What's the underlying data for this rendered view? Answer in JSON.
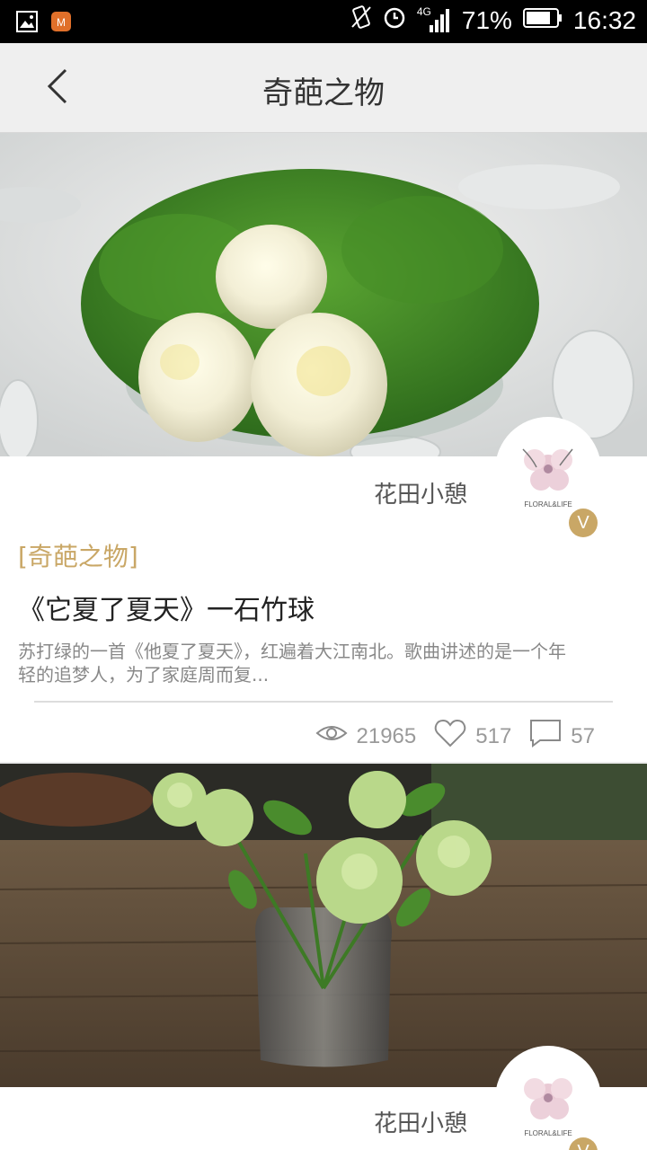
{
  "status_bar": {
    "left_icons": [
      "image-icon",
      "app-icon"
    ],
    "network": "4G",
    "battery": "71%",
    "time": "16:32"
  },
  "header": {
    "title": "奇葩之物",
    "back_icon": "chevron-left-icon"
  },
  "cards": [
    {
      "author": "花田小憩",
      "category": "[奇葩之物]",
      "title": "《它夏了夏天》一石竹球",
      "summary": "苏打绿的一首《他夏了夏天》，红遍着大江南北。歌曲讲述的是一个年轻的追梦人，为了家庭周而复...",
      "views": "21965",
      "likes": "517",
      "comments": "57",
      "badge": "V",
      "avatar_logo_text": "FLORAL&LIFE"
    },
    {
      "author": "花田小憩",
      "badge": "V",
      "avatar_logo_text": "FLORAL&LIFE"
    }
  ],
  "colors": {
    "accent": "#c9a766",
    "header_bg": "#efefef",
    "status_bg": "#000000"
  }
}
